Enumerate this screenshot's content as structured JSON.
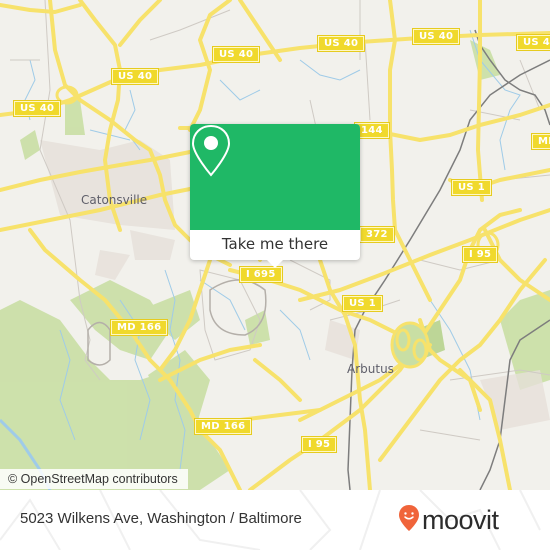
{
  "map": {
    "road_shields": {
      "us40_a": "US 40",
      "us40_b": "US 40",
      "us40_c": "US 40",
      "us40_d": "US 40",
      "us40_e": "US 40",
      "md144": "144",
      "md372": "372",
      "us1_a": "US 1",
      "us1_b": "US 1",
      "i95_a": "I 95",
      "i95_b": "I 95",
      "i695": "I 695",
      "md166_a": "MD 166",
      "md166_b": "MD 166",
      "md_right": "MD"
    },
    "places": {
      "catonsville": "Catonsville",
      "arbutus": "Arbutus"
    },
    "attribution": "© OpenStreetMap contributors",
    "colors": {
      "background": "#f2f1ec",
      "major_road": "#f7e26b",
      "park": "#c8dea0",
      "water": "#9fcbe8",
      "accent": "#1fb866"
    }
  },
  "popup": {
    "icon": "location-pin-icon",
    "button_label": "Take me there"
  },
  "footer": {
    "address": "5023 Wilkens Ave, Washington / Baltimore",
    "logo_text": "moovit",
    "logo_icon": "moovit-pin-smile-icon",
    "logo_color": "#f0643a"
  }
}
